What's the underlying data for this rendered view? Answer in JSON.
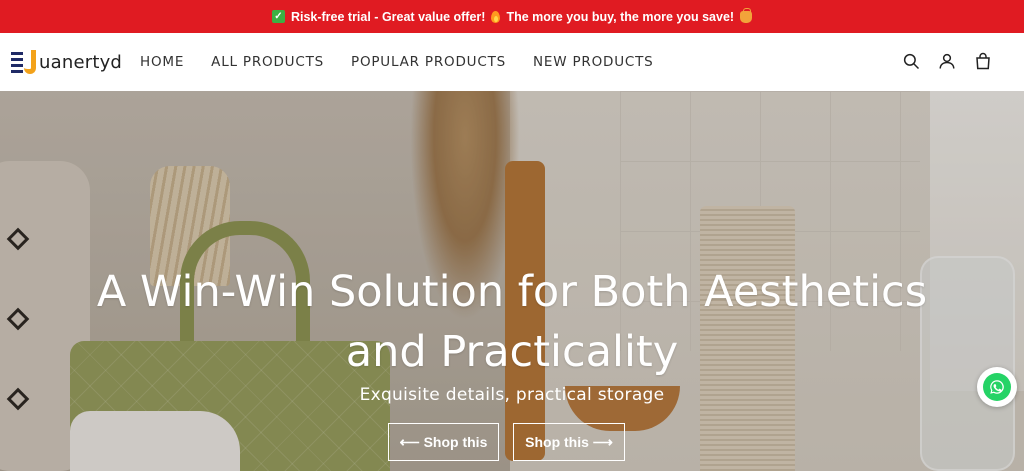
{
  "announcement": {
    "text_1": "Risk-free trial - Great value offer!",
    "text_2": "The more you buy, the more you save!"
  },
  "brand": {
    "name": "uanertyd"
  },
  "nav": {
    "items": [
      "HOME",
      "ALL PRODUCTS",
      "POPULAR PRODUCTS",
      "NEW PRODUCTS"
    ]
  },
  "header_icons": [
    "search-icon",
    "account-icon",
    "cart-icon"
  ],
  "hero": {
    "title_line_1": "A Win-Win Solution for Both Aesthetics",
    "title_line_2": "and Practicality",
    "subtitle": "Exquisite details, practical storage",
    "button_1": "⟵ Shop this",
    "button_2": "Shop this ⟶"
  },
  "colors": {
    "announcement_bg": "#e01b22",
    "whatsapp": "#25d366"
  }
}
